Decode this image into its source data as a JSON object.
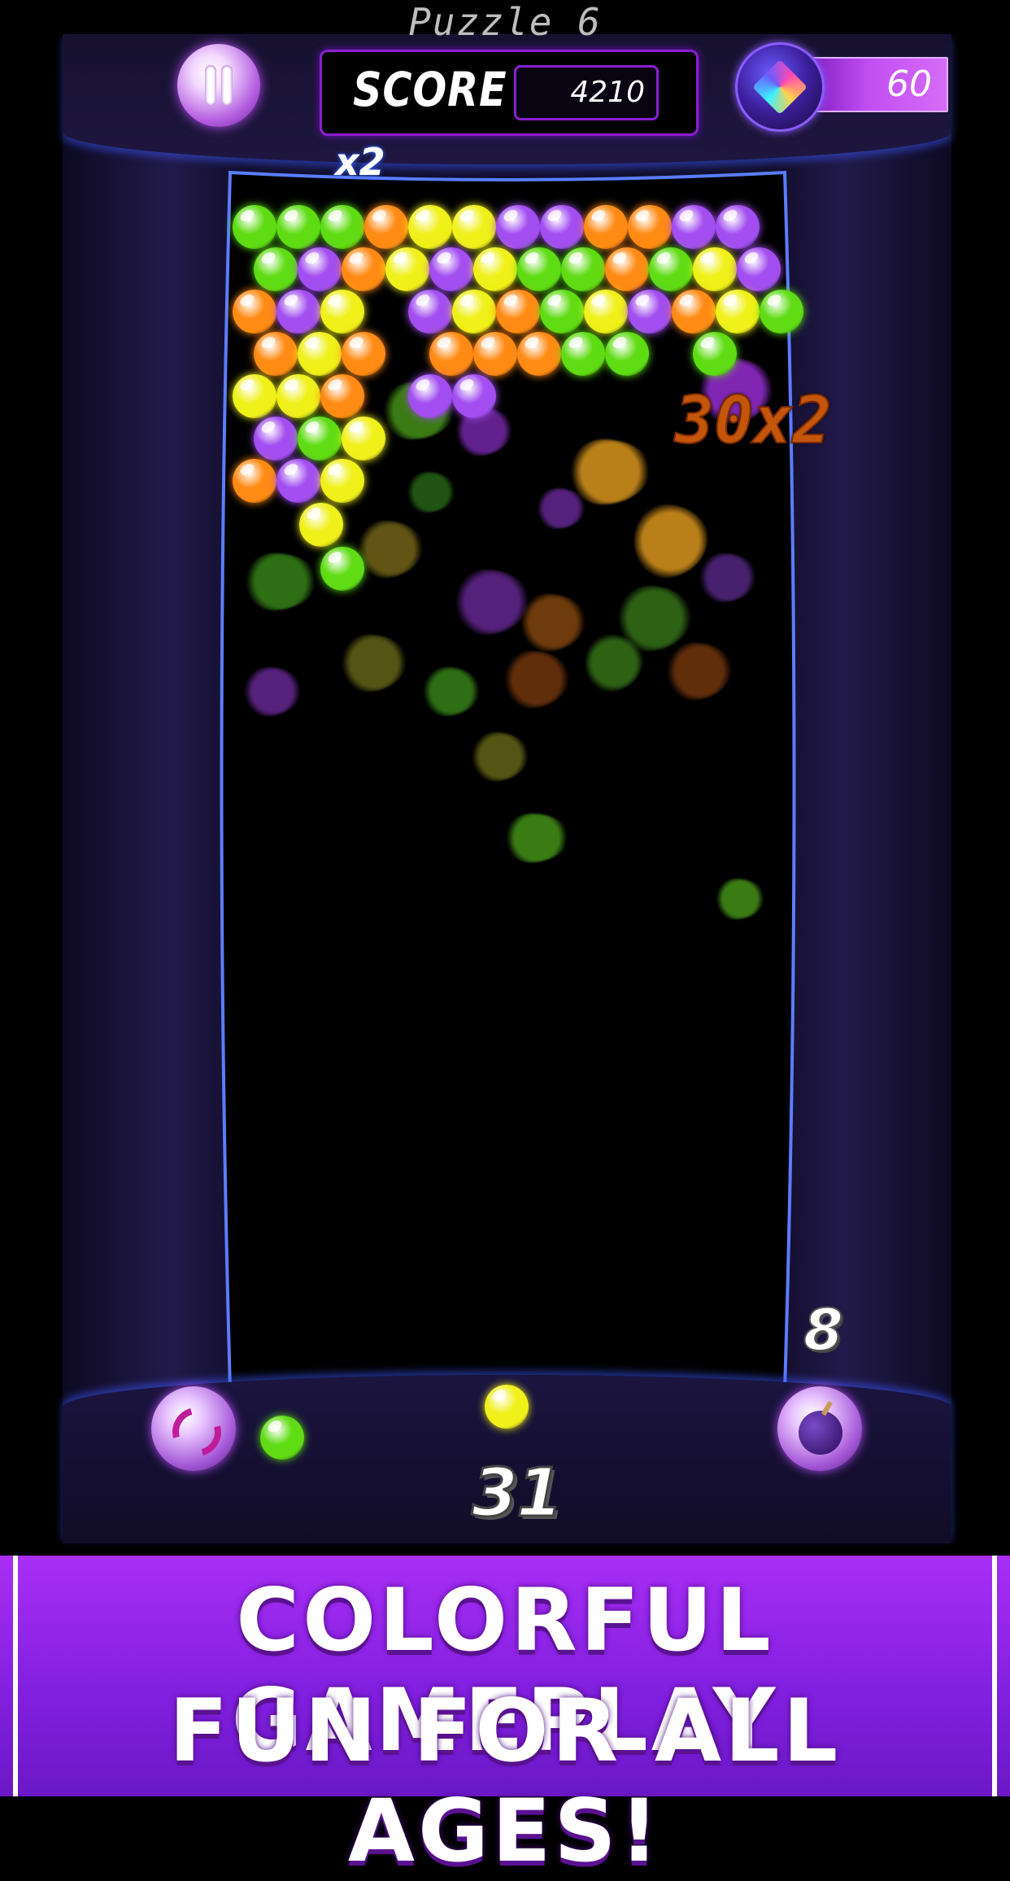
{
  "header": {
    "puzzle_title": "Puzzle 6",
    "score_label": "SCORE",
    "score_value": "4210",
    "gem_count": "60",
    "pause_icon": "pause-icon",
    "gem_icon": "diamond-icon"
  },
  "playfield": {
    "multiplier": "x2",
    "combo_popup": "30x2",
    "bubble_colors": {
      "G": "#5fdc14",
      "Y": "#f0f01a",
      "O": "#ff8a14",
      "P": "#a24ef0"
    },
    "rows": [
      "GGGOYYPPOOPP",
      "GPOYPYGGOGYP",
      "OPY PYOGYPOYG",
      "OYO OOOGG G",
      "YYO PP",
      "PGY",
      "OPY",
      "Y",
      "G"
    ]
  },
  "footer": {
    "bomb_count": "8",
    "shots_left": "31",
    "current_bubble": "Y",
    "next_bubble": "G",
    "swap_icon": "swap-icon",
    "bomb_icon": "bomb-icon"
  },
  "banner": {
    "line1": "COLORFUL GAMEPLAY",
    "line2": "FUN FOR ALL AGES!"
  }
}
